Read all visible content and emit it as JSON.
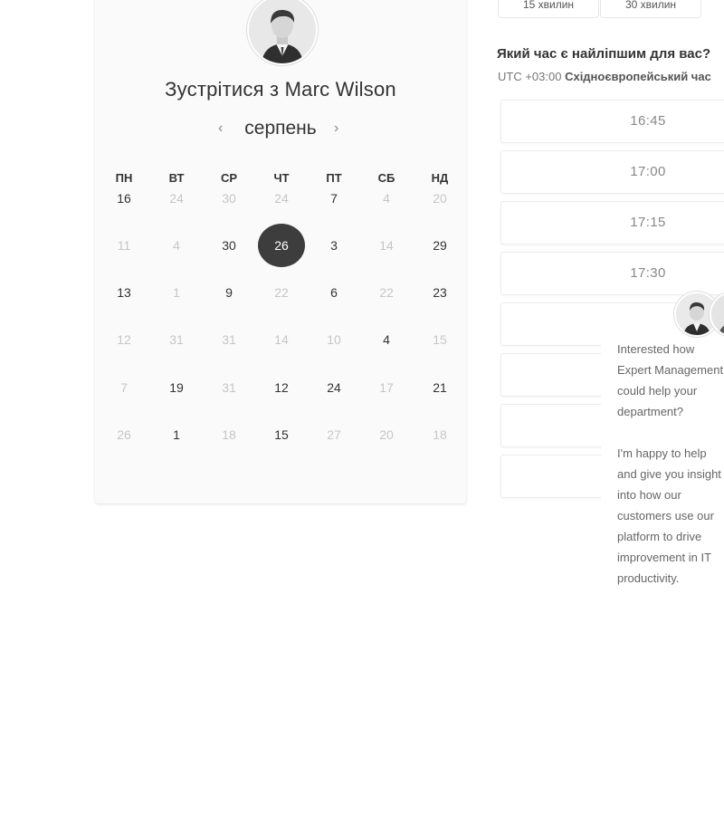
{
  "duration_options": [
    "15 хвилин",
    "30 хвилин"
  ],
  "host": {
    "title": "Зустрітися з Marc Wilson"
  },
  "calendar": {
    "month": "серпень",
    "prev_icon": "chevron-left-icon",
    "next_icon": "chevron-right-icon",
    "weekdays": [
      "ПН",
      "ВТ",
      "СР",
      "ЧТ",
      "ПТ",
      "СБ",
      "НД"
    ],
    "weeks": [
      [
        {
          "n": "16",
          "s": "active"
        },
        {
          "n": "24",
          "s": "dim"
        },
        {
          "n": "30",
          "s": "dim"
        },
        {
          "n": "24",
          "s": "dim"
        },
        {
          "n": "7",
          "s": "active"
        },
        {
          "n": "4",
          "s": "dim"
        },
        {
          "n": "20",
          "s": "dim"
        }
      ],
      [
        {
          "n": "11",
          "s": "dim"
        },
        {
          "n": "4",
          "s": "dim"
        },
        {
          "n": "30",
          "s": "active"
        },
        {
          "n": "26",
          "s": "selected"
        },
        {
          "n": "3",
          "s": "active"
        },
        {
          "n": "14",
          "s": "dim"
        },
        {
          "n": "29",
          "s": "active"
        }
      ],
      [
        {
          "n": "13",
          "s": "active"
        },
        {
          "n": "1",
          "s": "dim"
        },
        {
          "n": "9",
          "s": "active"
        },
        {
          "n": "22",
          "s": "dim"
        },
        {
          "n": "6",
          "s": "active"
        },
        {
          "n": "22",
          "s": "dim"
        },
        {
          "n": "23",
          "s": "active"
        }
      ],
      [
        {
          "n": "12",
          "s": "dim"
        },
        {
          "n": "31",
          "s": "dim"
        },
        {
          "n": "31",
          "s": "dim"
        },
        {
          "n": "14",
          "s": "dim"
        },
        {
          "n": "10",
          "s": "dim"
        },
        {
          "n": "4",
          "s": "active"
        },
        {
          "n": "15",
          "s": "dim"
        }
      ],
      [
        {
          "n": "7",
          "s": "dim"
        },
        {
          "n": "19",
          "s": "active"
        },
        {
          "n": "31",
          "s": "dim"
        },
        {
          "n": "12",
          "s": "active"
        },
        {
          "n": "24",
          "s": "active"
        },
        {
          "n": "17",
          "s": "dim"
        },
        {
          "n": "21",
          "s": "active"
        }
      ],
      [
        {
          "n": "26",
          "s": "dim"
        },
        {
          "n": "1",
          "s": "active"
        },
        {
          "n": "18",
          "s": "dim"
        },
        {
          "n": "15",
          "s": "active"
        },
        {
          "n": "27",
          "s": "dim"
        },
        {
          "n": "20",
          "s": "dim"
        },
        {
          "n": "18",
          "s": "dim"
        }
      ]
    ]
  },
  "times": {
    "question": "Який час є найліпшим для вас?",
    "timezone_offset": "UTC +03:00",
    "timezone_name": "Східноєвропейський час",
    "slots": [
      "16:45",
      "17:00",
      "17:15",
      "17:30",
      "",
      "",
      "",
      ""
    ]
  },
  "chat": {
    "message": "Interested how Expert Management could help your department?\n\nI'm happy to help and give you insight into how our customers use our platform to drive improvement in IT productivity."
  },
  "colors": {
    "selected_day": "#3d3d3d",
    "dim_text": "#c6c6c6",
    "card_bg": "#fafafa"
  }
}
